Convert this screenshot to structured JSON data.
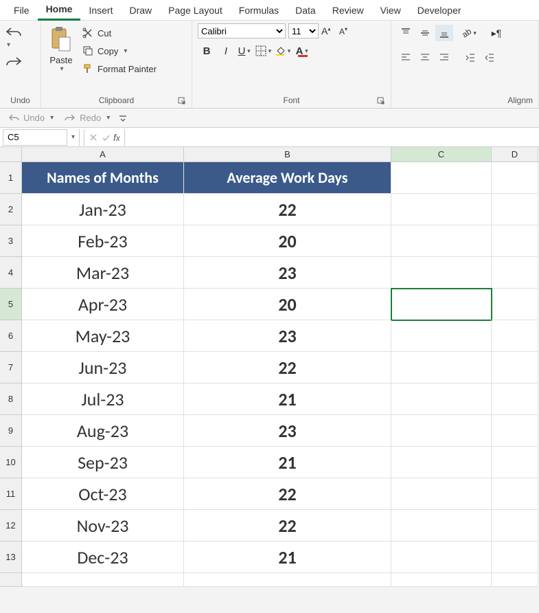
{
  "menu": {
    "tabs": [
      "File",
      "Home",
      "Insert",
      "Draw",
      "Page Layout",
      "Formulas",
      "Data",
      "Review",
      "View",
      "Developer"
    ],
    "active": "Home"
  },
  "ribbon": {
    "undo_label": "Undo",
    "clipboard": {
      "label": "Clipboard",
      "paste": "Paste",
      "cut": "Cut",
      "copy": "Copy",
      "format_painter": "Format Painter"
    },
    "font": {
      "label": "Font",
      "name": "Calibri",
      "size": "11"
    },
    "alignment": {
      "label": "Alignm"
    }
  },
  "qat": {
    "undo": "Undo",
    "redo": "Redo"
  },
  "namebox": "C5",
  "formula": "",
  "columns": [
    "A",
    "B",
    "C",
    "D"
  ],
  "selected_row": 5,
  "selected_col": "C",
  "table": {
    "header": [
      "Names of Months",
      "Average Work Days"
    ],
    "rows": [
      {
        "month": "Jan-23",
        "days": "22"
      },
      {
        "month": "Feb-23",
        "days": "20"
      },
      {
        "month": "Mar-23",
        "days": "23"
      },
      {
        "month": "Apr-23",
        "days": "20"
      },
      {
        "month": "May-23",
        "days": "23"
      },
      {
        "month": "Jun-23",
        "days": "22"
      },
      {
        "month": "Jul-23",
        "days": "21"
      },
      {
        "month": "Aug-23",
        "days": "23"
      },
      {
        "month": "Sep-23",
        "days": "21"
      },
      {
        "month": "Oct-23",
        "days": "22"
      },
      {
        "month": "Nov-23",
        "days": "22"
      },
      {
        "month": "Dec-23",
        "days": "21"
      }
    ]
  },
  "rowcount": 14
}
